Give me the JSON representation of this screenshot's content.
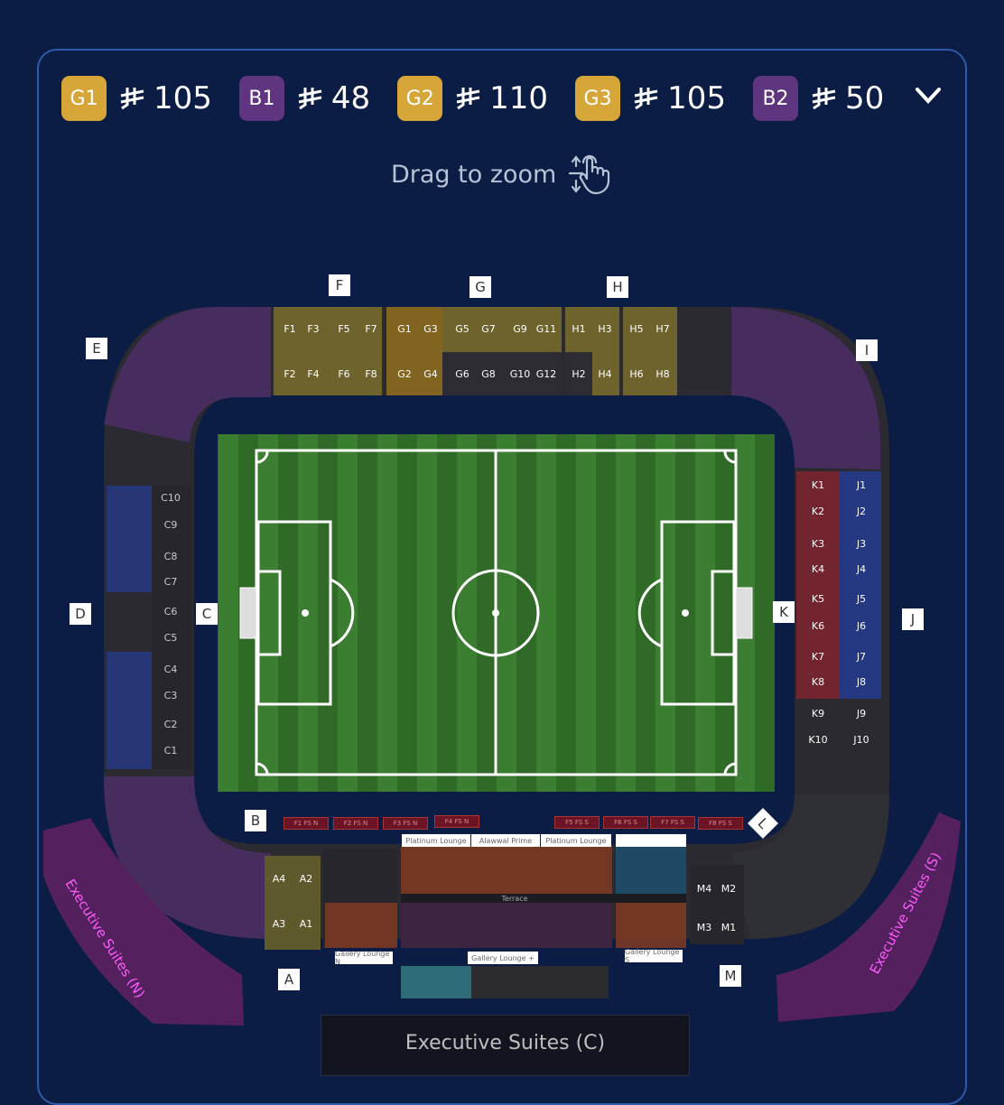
{
  "prices": [
    {
      "tier": "G1",
      "amount": "105",
      "color": "#d6a638"
    },
    {
      "tier": "B1",
      "amount": "48",
      "color": "#60357f"
    },
    {
      "tier": "G2",
      "amount": "110",
      "color": "#d6a638"
    },
    {
      "tier": "G3",
      "amount": "105",
      "color": "#d6a638"
    },
    {
      "tier": "B2",
      "amount": "50",
      "color": "#60357f"
    }
  ],
  "currency_icon": "saudi-riyal-icon",
  "hint": {
    "text": "Drag to zoom",
    "icon": "pinch-zoom-icon"
  },
  "sections": {
    "A": "A",
    "B": "B",
    "C": "C",
    "D": "D",
    "E": "E",
    "F": "F",
    "G": "G",
    "H": "H",
    "I": "I",
    "J": "J",
    "K": "K",
    "L": "L",
    "M": "M"
  },
  "blocks_top_row1": [
    "F1",
    "F3",
    "F5",
    "F7",
    "G1",
    "G3",
    "G5",
    "G7",
    "G9",
    "G11",
    "H1",
    "H3",
    "H5",
    "H7"
  ],
  "blocks_top_row2": [
    "F2",
    "F4",
    "F6",
    "F8",
    "G2",
    "G4",
    "G6",
    "G8",
    "G10",
    "G12",
    "H2",
    "H4",
    "H6",
    "H8"
  ],
  "blocks_left": [
    "C10",
    "C9",
    "C8",
    "C7",
    "C6",
    "C5",
    "C4",
    "C3",
    "C2",
    "C1"
  ],
  "blocks_right_k": [
    "K1",
    "K2",
    "K3",
    "K4",
    "K5",
    "K6",
    "K7",
    "K8",
    "K9",
    "K10"
  ],
  "blocks_right_j": [
    "J1",
    "J2",
    "J3",
    "J4",
    "J5",
    "J6",
    "J7",
    "J8",
    "J9",
    "J10"
  ],
  "blocks_a": [
    "A4",
    "A2",
    "A3",
    "A1"
  ],
  "blocks_m": [
    "M4",
    "M2",
    "M3",
    "M1"
  ],
  "family_sections": [
    "F1 FS N",
    "F2 FS N",
    "F3 FS N",
    "F4 FS N",
    "F5 FS S",
    "F6 FS S",
    "F7 FS S",
    "F8 FS S"
  ],
  "lounges": {
    "platinum_n": "Platinum Lounge",
    "alawwal": "Alawwal Prime",
    "platinum_s": "Platinum Lounge",
    "terrace": "Terrace",
    "gallery_n": "Gallery Lounge N",
    "gallery_plus": "Gallery Lounge +",
    "gallery_s": "Gallery Lounge S"
  },
  "executive_suites": {
    "north": "Executive Suites (N)",
    "south": "Executive Suites (S)",
    "center": "Executive Suites (C)"
  }
}
